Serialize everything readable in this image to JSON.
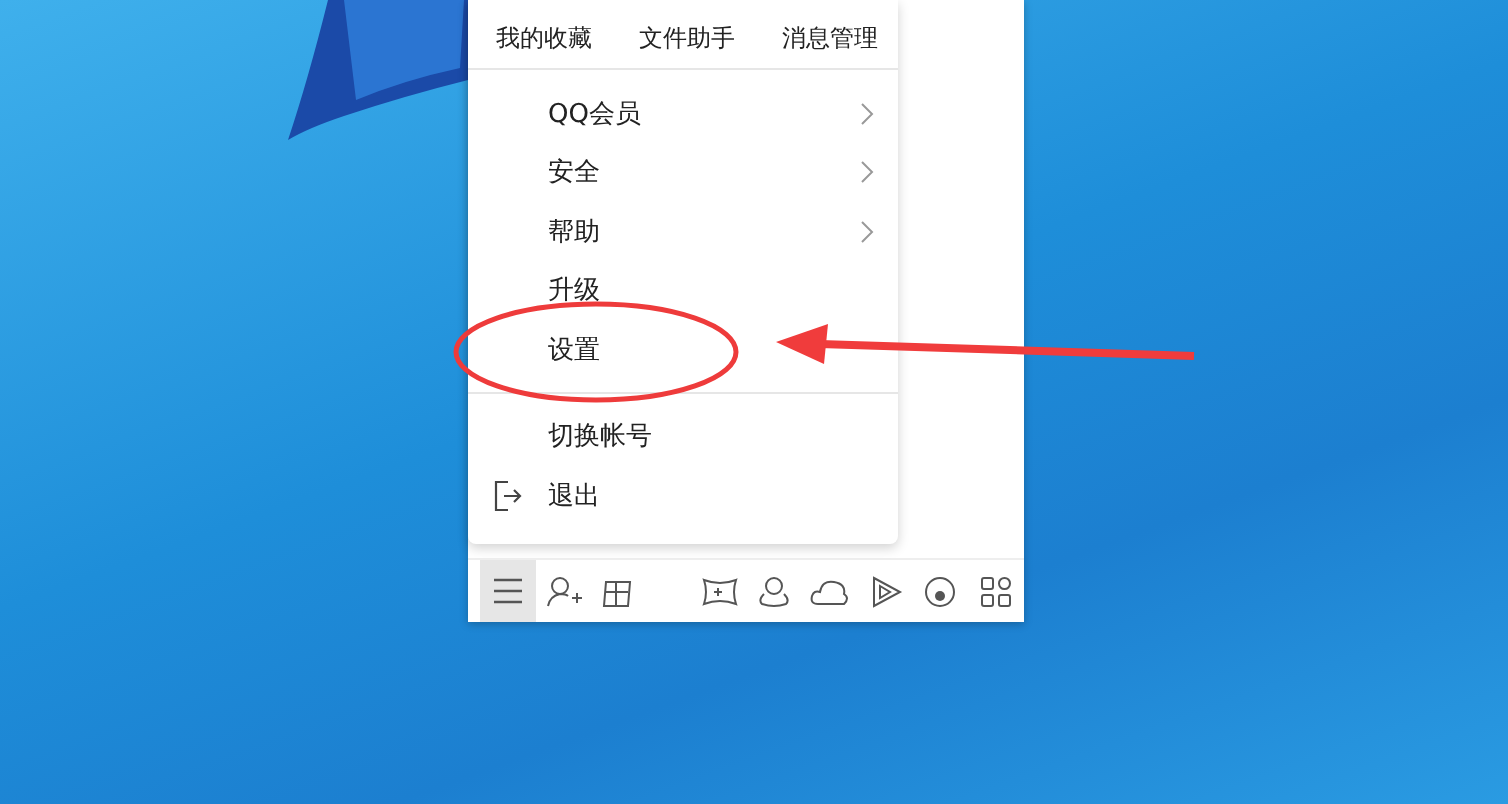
{
  "quick_links": [
    "我的收藏",
    "文件助手",
    "消息管理"
  ],
  "menu_sections": [
    [
      {
        "label": "QQ会员",
        "kind": "submenu"
      },
      {
        "label": "安全",
        "kind": "submenu"
      },
      {
        "label": "帮助",
        "kind": "submenu"
      },
      {
        "label": "升级",
        "kind": "plain"
      },
      {
        "label": "设置",
        "kind": "plain"
      }
    ],
    [
      {
        "label": "切换帐号",
        "kind": "plain"
      },
      {
        "label": "退出",
        "kind": "exit"
      }
    ]
  ],
  "menu_button": {
    "selected": true
  }
}
